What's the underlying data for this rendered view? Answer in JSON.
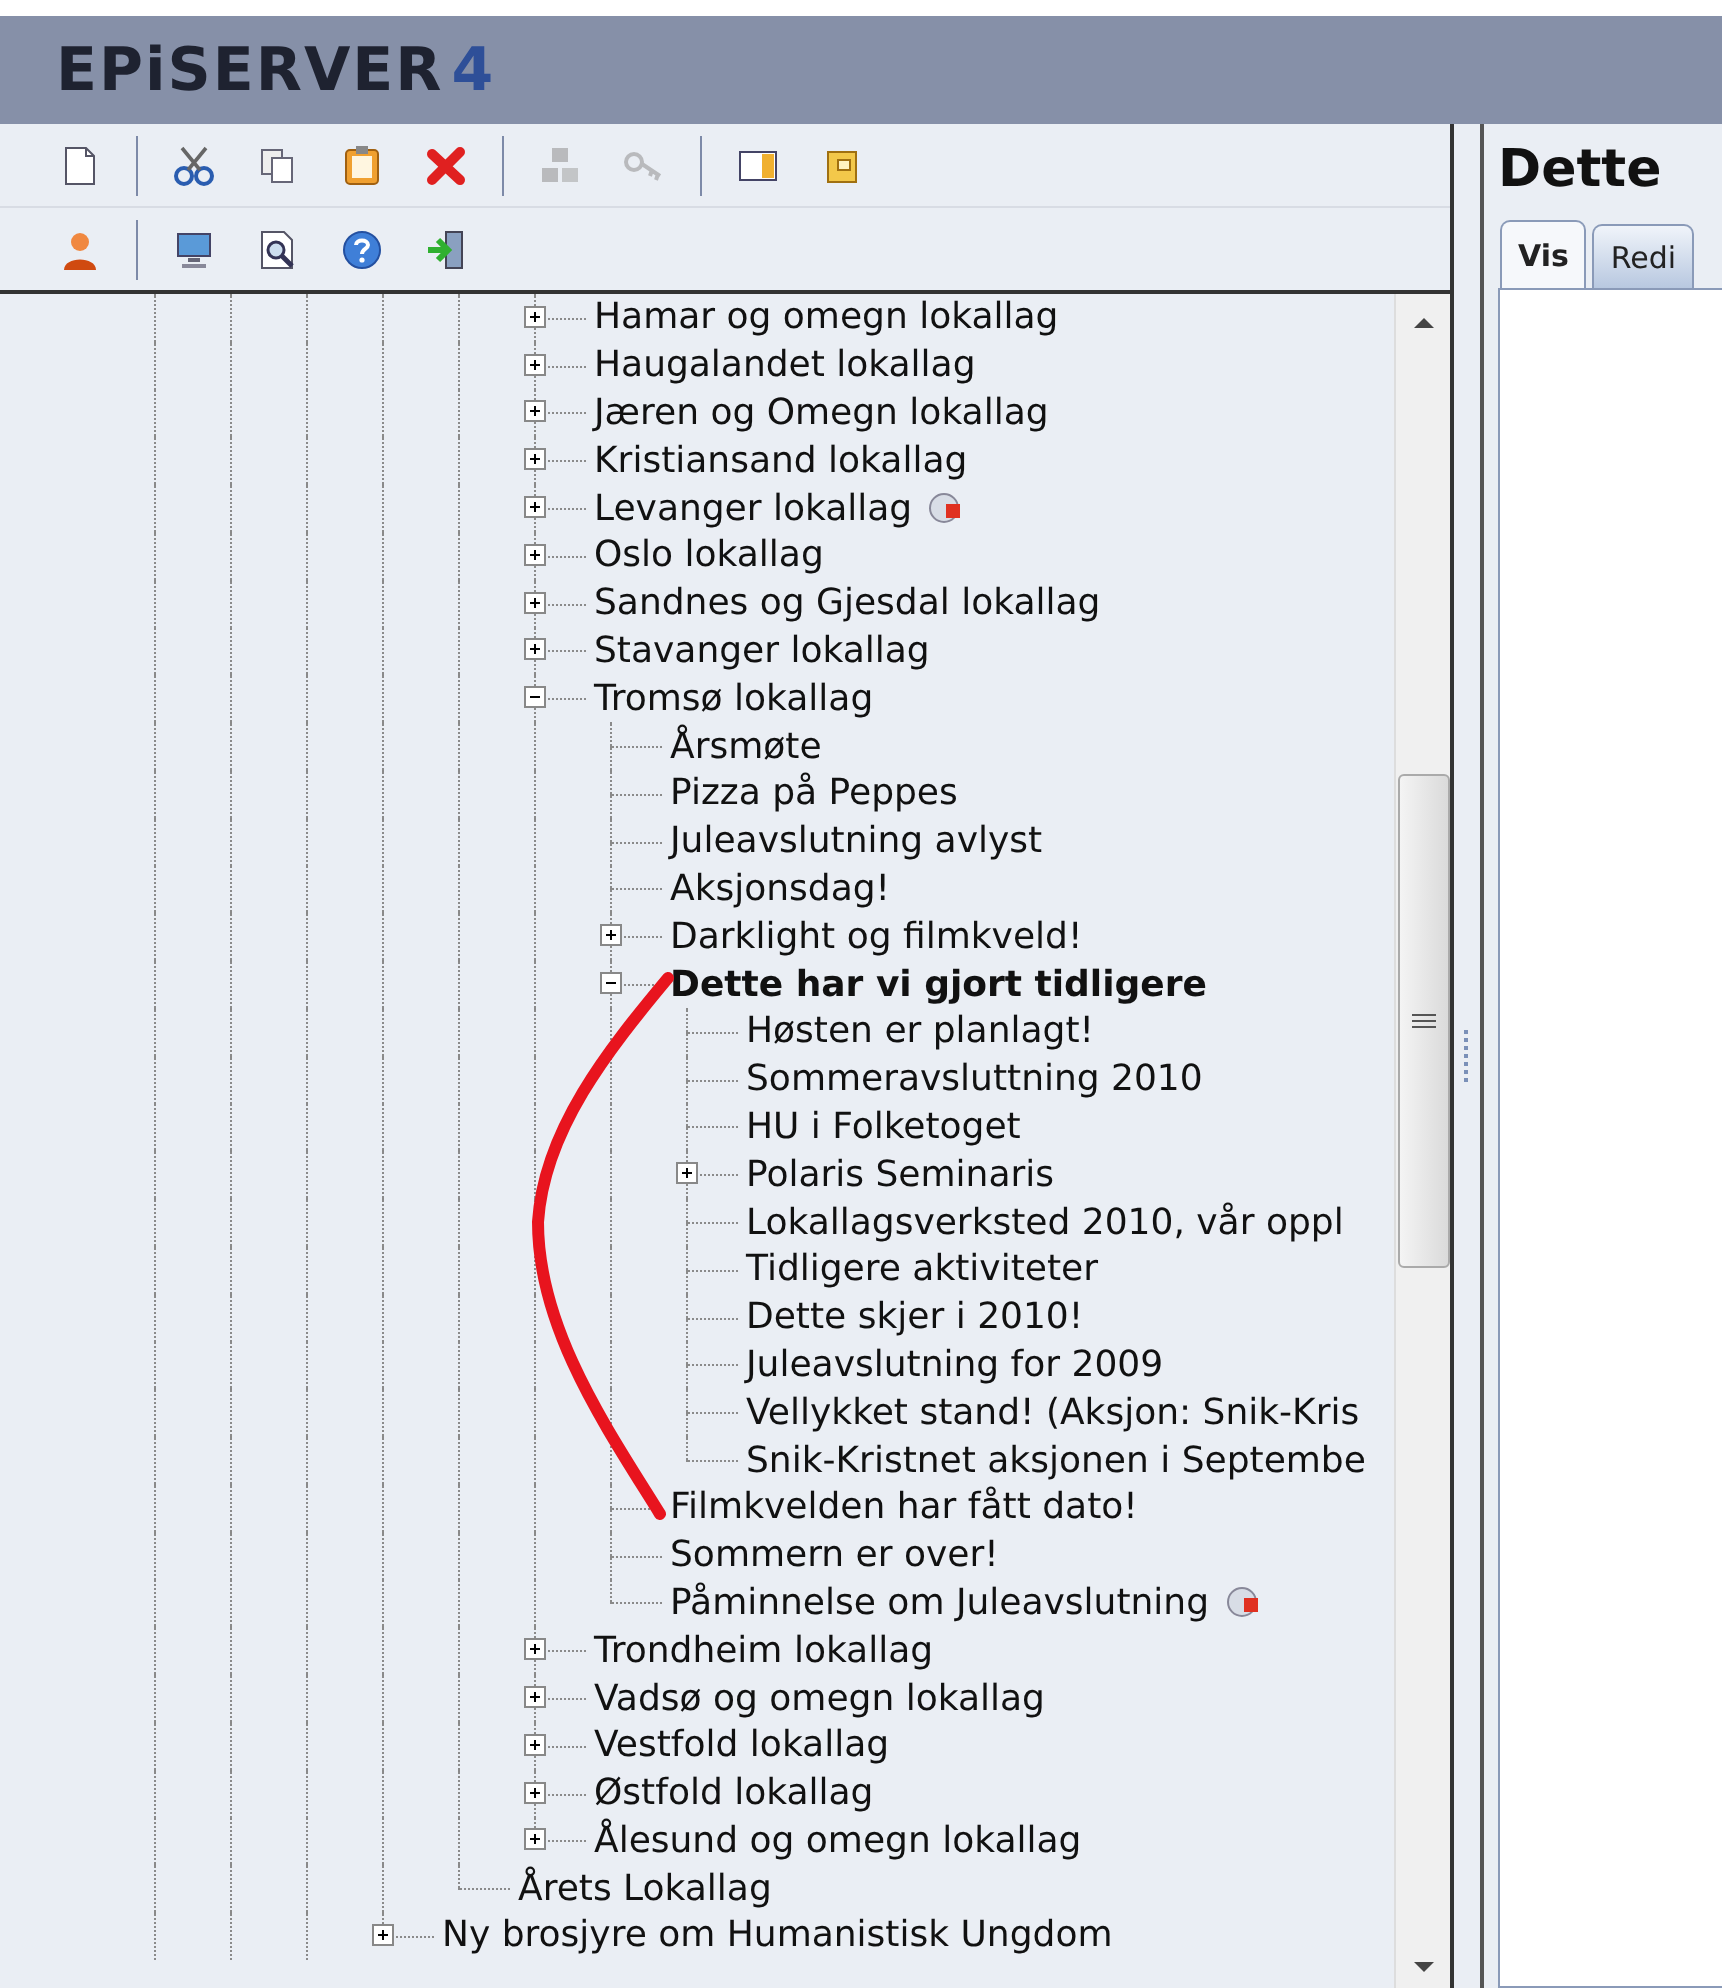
{
  "logo": {
    "text": "EPiSERVER",
    "version": "4"
  },
  "toolbars": [
    {
      "groups": [
        [
          {
            "kind": "new",
            "disabled": false
          }
        ],
        [
          {
            "kind": "cut",
            "disabled": false
          },
          {
            "kind": "copy",
            "disabled": false
          },
          {
            "kind": "paste",
            "disabled": false
          },
          {
            "kind": "delete",
            "disabled": false
          }
        ],
        [
          {
            "kind": "structure",
            "disabled": true
          },
          {
            "kind": "key",
            "disabled": true
          }
        ],
        [
          {
            "kind": "panel",
            "disabled": false
          },
          {
            "kind": "box",
            "disabled": false
          }
        ]
      ]
    },
    {
      "groups": [
        [
          {
            "kind": "user",
            "disabled": false
          }
        ],
        [
          {
            "kind": "monitor",
            "disabled": false
          },
          {
            "kind": "preview",
            "disabled": false
          },
          {
            "kind": "help",
            "disabled": false
          },
          {
            "kind": "exit",
            "disabled": false
          }
        ]
      ]
    }
  ],
  "tree": {
    "items": [
      {
        "children": [
          {
            "children": [
              {
                "label": "Hamar og omegn lokallag",
                "expanded": false,
                "selected": false
              },
              {
                "label": "Haugalandet lokallag",
                "expanded": false,
                "selected": false
              },
              {
                "label": "Jæren og Omegn lokallag",
                "expanded": false,
                "selected": false
              },
              {
                "label": "Kristiansand lokallag",
                "expanded": false,
                "selected": false
              },
              {
                "label": "Levanger lokallag",
                "expanded": false,
                "selected": false,
                "flagged": true
              },
              {
                "label": "Oslo lokallag",
                "expanded": false,
                "selected": false
              },
              {
                "label": "Sandnes og Gjesdal lokallag",
                "expanded": false,
                "selected": false
              },
              {
                "label": "Stavanger lokallag",
                "expanded": false,
                "selected": false
              },
              {
                "label": "Tromsø lokallag",
                "expanded": true,
                "selected": false,
                "children": [
                  {
                    "label": "Årsmøte",
                    "selected": false
                  },
                  {
                    "label": "Pizza på Peppes",
                    "selected": false
                  },
                  {
                    "label": "Juleavslutning avlyst",
                    "selected": false
                  },
                  {
                    "label": "Aksjonsdag!",
                    "selected": false
                  },
                  {
                    "label": "Darklight og filmkveld!",
                    "expanded": false,
                    "selected": false
                  },
                  {
                    "label": "Dette har vi gjort tidligere",
                    "expanded": true,
                    "selected": true,
                    "children": [
                      {
                        "label": "Høsten er planlagt!",
                        "selected": false
                      },
                      {
                        "label": "Sommeravsluttning 2010",
                        "selected": false
                      },
                      {
                        "label": "HU i Folketoget",
                        "selected": false
                      },
                      {
                        "label": "Polaris Seminaris",
                        "expanded": false,
                        "selected": false
                      },
                      {
                        "label": "Lokallagsverksted 2010, vår oppl",
                        "selected": false
                      },
                      {
                        "label": "Tidligere aktiviteter",
                        "selected": false
                      },
                      {
                        "label": "Dette skjer i 2010!",
                        "selected": false
                      },
                      {
                        "label": "Juleavslutning for 2009",
                        "selected": false
                      },
                      {
                        "label": "Vellykket stand! (Aksjon: Snik-Kris",
                        "selected": false
                      },
                      {
                        "label": "Snik-Kristnet aksjonen i Septembe",
                        "selected": false
                      }
                    ]
                  },
                  {
                    "label": "Filmkvelden har fått dato!",
                    "selected": false
                  },
                  {
                    "label": "Sommern er over!",
                    "selected": false
                  },
                  {
                    "label": "Påminnelse om Juleavslutning",
                    "selected": false,
                    "flagged": true
                  }
                ]
              },
              {
                "label": "Trondheim lokallag",
                "expanded": false,
                "selected": false
              },
              {
                "label": "Vadsø og omegn lokallag",
                "expanded": false,
                "selected": false
              },
              {
                "label": "Vestfold lokallag",
                "expanded": false,
                "selected": false
              },
              {
                "label": "Østfold lokallag",
                "expanded": false,
                "selected": false
              },
              {
                "label": "Ålesund og omegn lokallag",
                "expanded": false,
                "selected": false
              }
            ]
          },
          {
            "label": "Årets Lokallag",
            "selected": false
          }
        ]
      },
      {
        "label": "Ny brosjyre om Humanistisk Ungdom",
        "expanded": false,
        "selected": false
      }
    ]
  },
  "page": {
    "title": "Dette",
    "tabs": [
      {
        "label": "Vis",
        "selected": true
      },
      {
        "label": "Redi",
        "selected": false
      }
    ]
  }
}
